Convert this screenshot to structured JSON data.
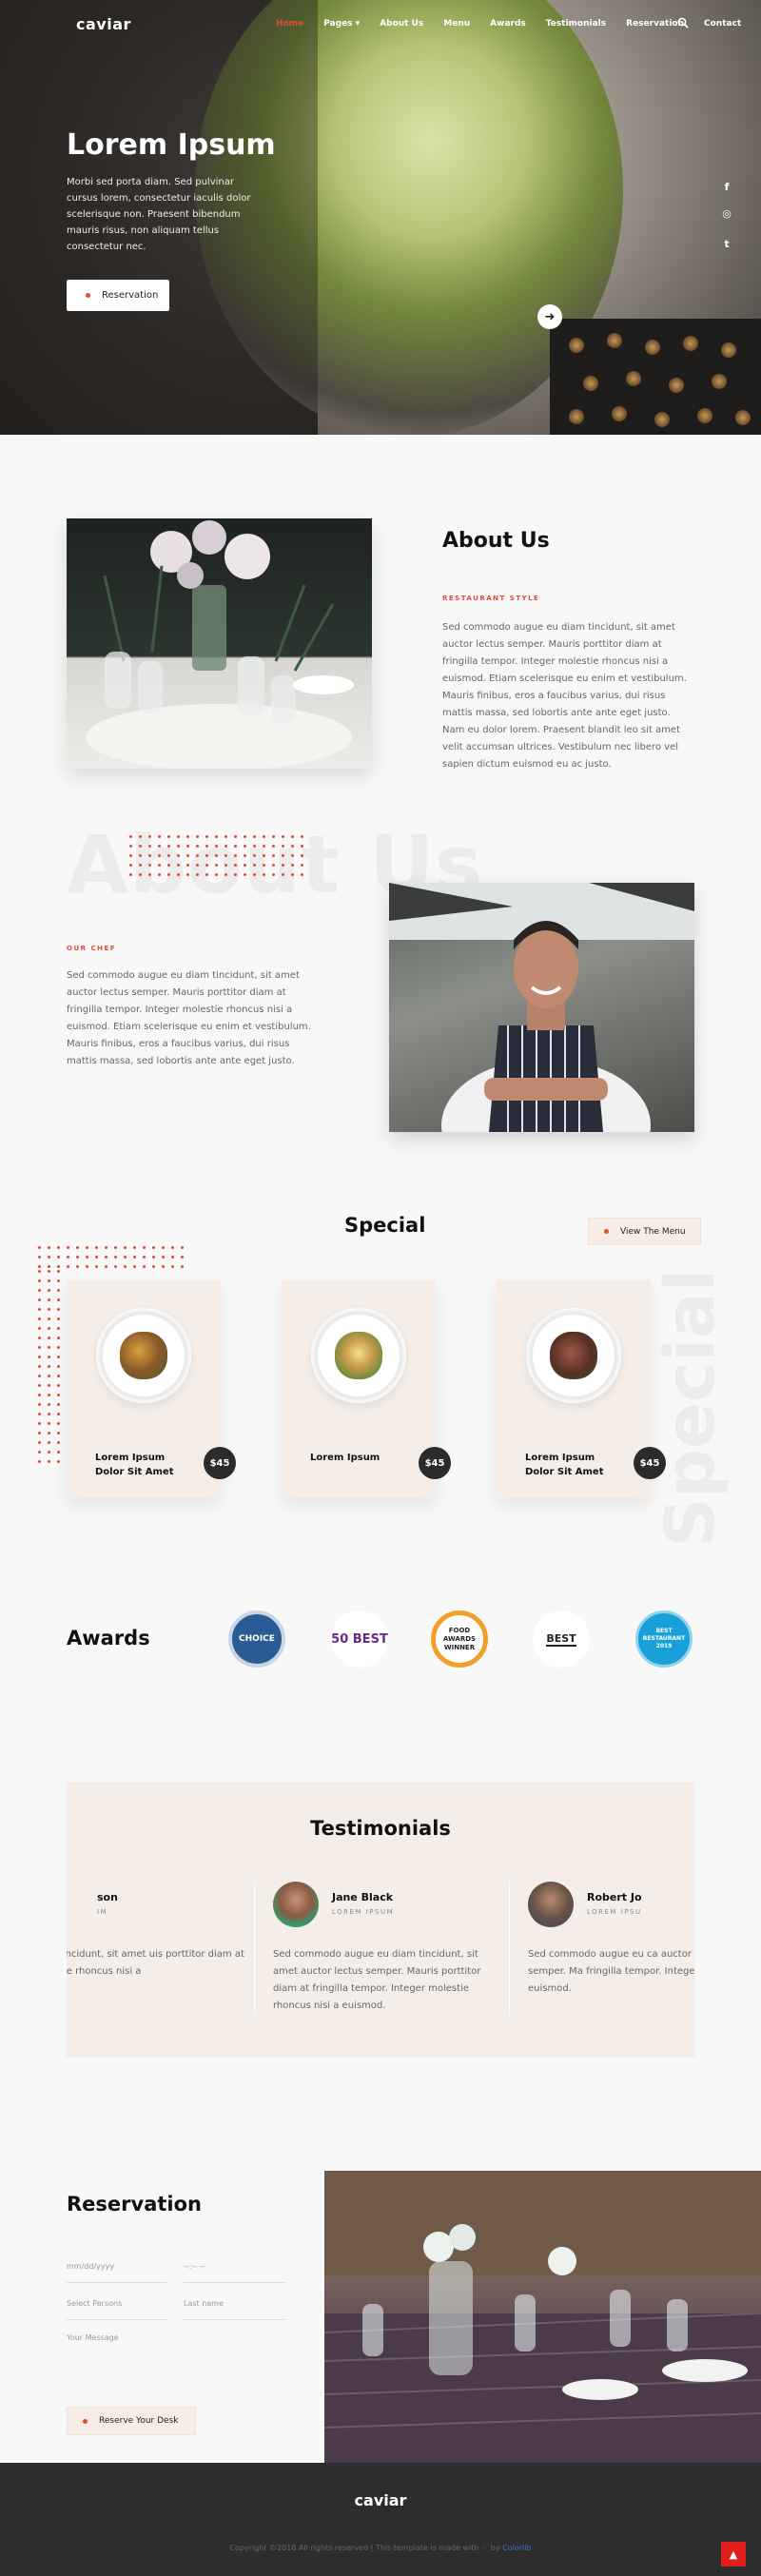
{
  "nav": {
    "brand": "caviar",
    "items": [
      {
        "label": "Home",
        "active": true
      },
      {
        "label": "Pages ▾",
        "active": false
      },
      {
        "label": "About Us",
        "active": false
      },
      {
        "label": "Menu",
        "active": false
      },
      {
        "label": "Awards",
        "active": false
      },
      {
        "label": "Testimonials",
        "active": false
      },
      {
        "label": "Reservation",
        "active": false
      },
      {
        "label": "Contact",
        "active": false
      }
    ]
  },
  "hero": {
    "title": "Lorem Ipsum",
    "text": "Morbi sed porta diam. Sed pulvinar cursus lorem, consectetur iaculis dolor scelerisque non. Praesent bibendum mauris risus, non aliquam tellus consectetur nec.",
    "button": "Reservation",
    "social": [
      "f",
      "◎",
      "t"
    ]
  },
  "about": {
    "title": "About Us",
    "subtitle": "RESTAURANT STYLE",
    "text": "Sed commodo augue eu diam tincidunt, sit amet auctor lectus semper. Mauris porttitor diam at fringilla tempor. Integer molestie rhoncus nisi a euismod. Etiam scelerisque eu enim et vestibulum. Mauris finibus, eros a faucibus varius, dui risus mattis massa, sed lobortis ante ante eget justo. Nam eu dolor lorem. Praesent blandit leo sit amet velit accumsan ultrices. Vestibulum nec libero vel sapien dictum euismod eu ac justo."
  },
  "chef": {
    "bg_word": "About Us",
    "subtitle": "OUR CHEF",
    "text": "Sed commodo augue eu diam tincidunt, sit amet auctor lectus semper. Mauris porttitor diam at fringilla tempor. Integer molestie rhoncus nisi a euismod. Etiam scelerisque eu enim et vestibulum. Mauris finibus, eros a faucibus varius, dui risus mattis massa, sed lobortis ante ante eget justo."
  },
  "special": {
    "title": "Special",
    "button": "View The Menu",
    "bg_word": "Special",
    "cards": [
      {
        "name": "Lorem Ipsum Dolor Sit Amet",
        "price": "$45"
      },
      {
        "name": "Lorem Ipsum",
        "price": "$45"
      },
      {
        "name": "Lorem Ipsum Dolor Sit Amet",
        "price": "$45"
      }
    ]
  },
  "awards": {
    "title": "Awards",
    "badges": [
      "CHOICE",
      "50 BEST",
      "FOOD AWARDS WINNER",
      "BEST",
      "BEST RESTAURANT 2019"
    ]
  },
  "testimonials": {
    "title": "Testimonials",
    "items": [
      {
        "name": "son",
        "role": "IM",
        "text": "iam tincidunt, sit amet uis porttitor diam at iolestie rhoncus nisi a"
      },
      {
        "name": "Jane Black",
        "role": "LOREM IPSUM",
        "text": "Sed commodo augue eu diam tincidunt, sit amet auctor lectus semper. Mauris porttitor diam at fringilla tempor. Integer molestie rhoncus nisi a euismod."
      },
      {
        "name": "Robert Jo",
        "role": "LOREM IPSU",
        "text": "Sed commodo augue eu ca auctor lectus semper. Ma fringilla tempor. Integer m euismod."
      }
    ]
  },
  "reservation": {
    "title": "Reservation",
    "date_placeholder": "mm/dd/yyyy",
    "time_placeholder": "--:-- --",
    "persons_placeholder": "Select Persons",
    "lastname_placeholder": "Last name",
    "message_placeholder": "Your Message",
    "button": "Reserve Your Desk"
  },
  "footer": {
    "brand": "caviar",
    "copyright": "Copyright ©2018 All rights reserved | This template is made with ♡ by ",
    "link": "Colorlib",
    "to_top": "▲"
  }
}
